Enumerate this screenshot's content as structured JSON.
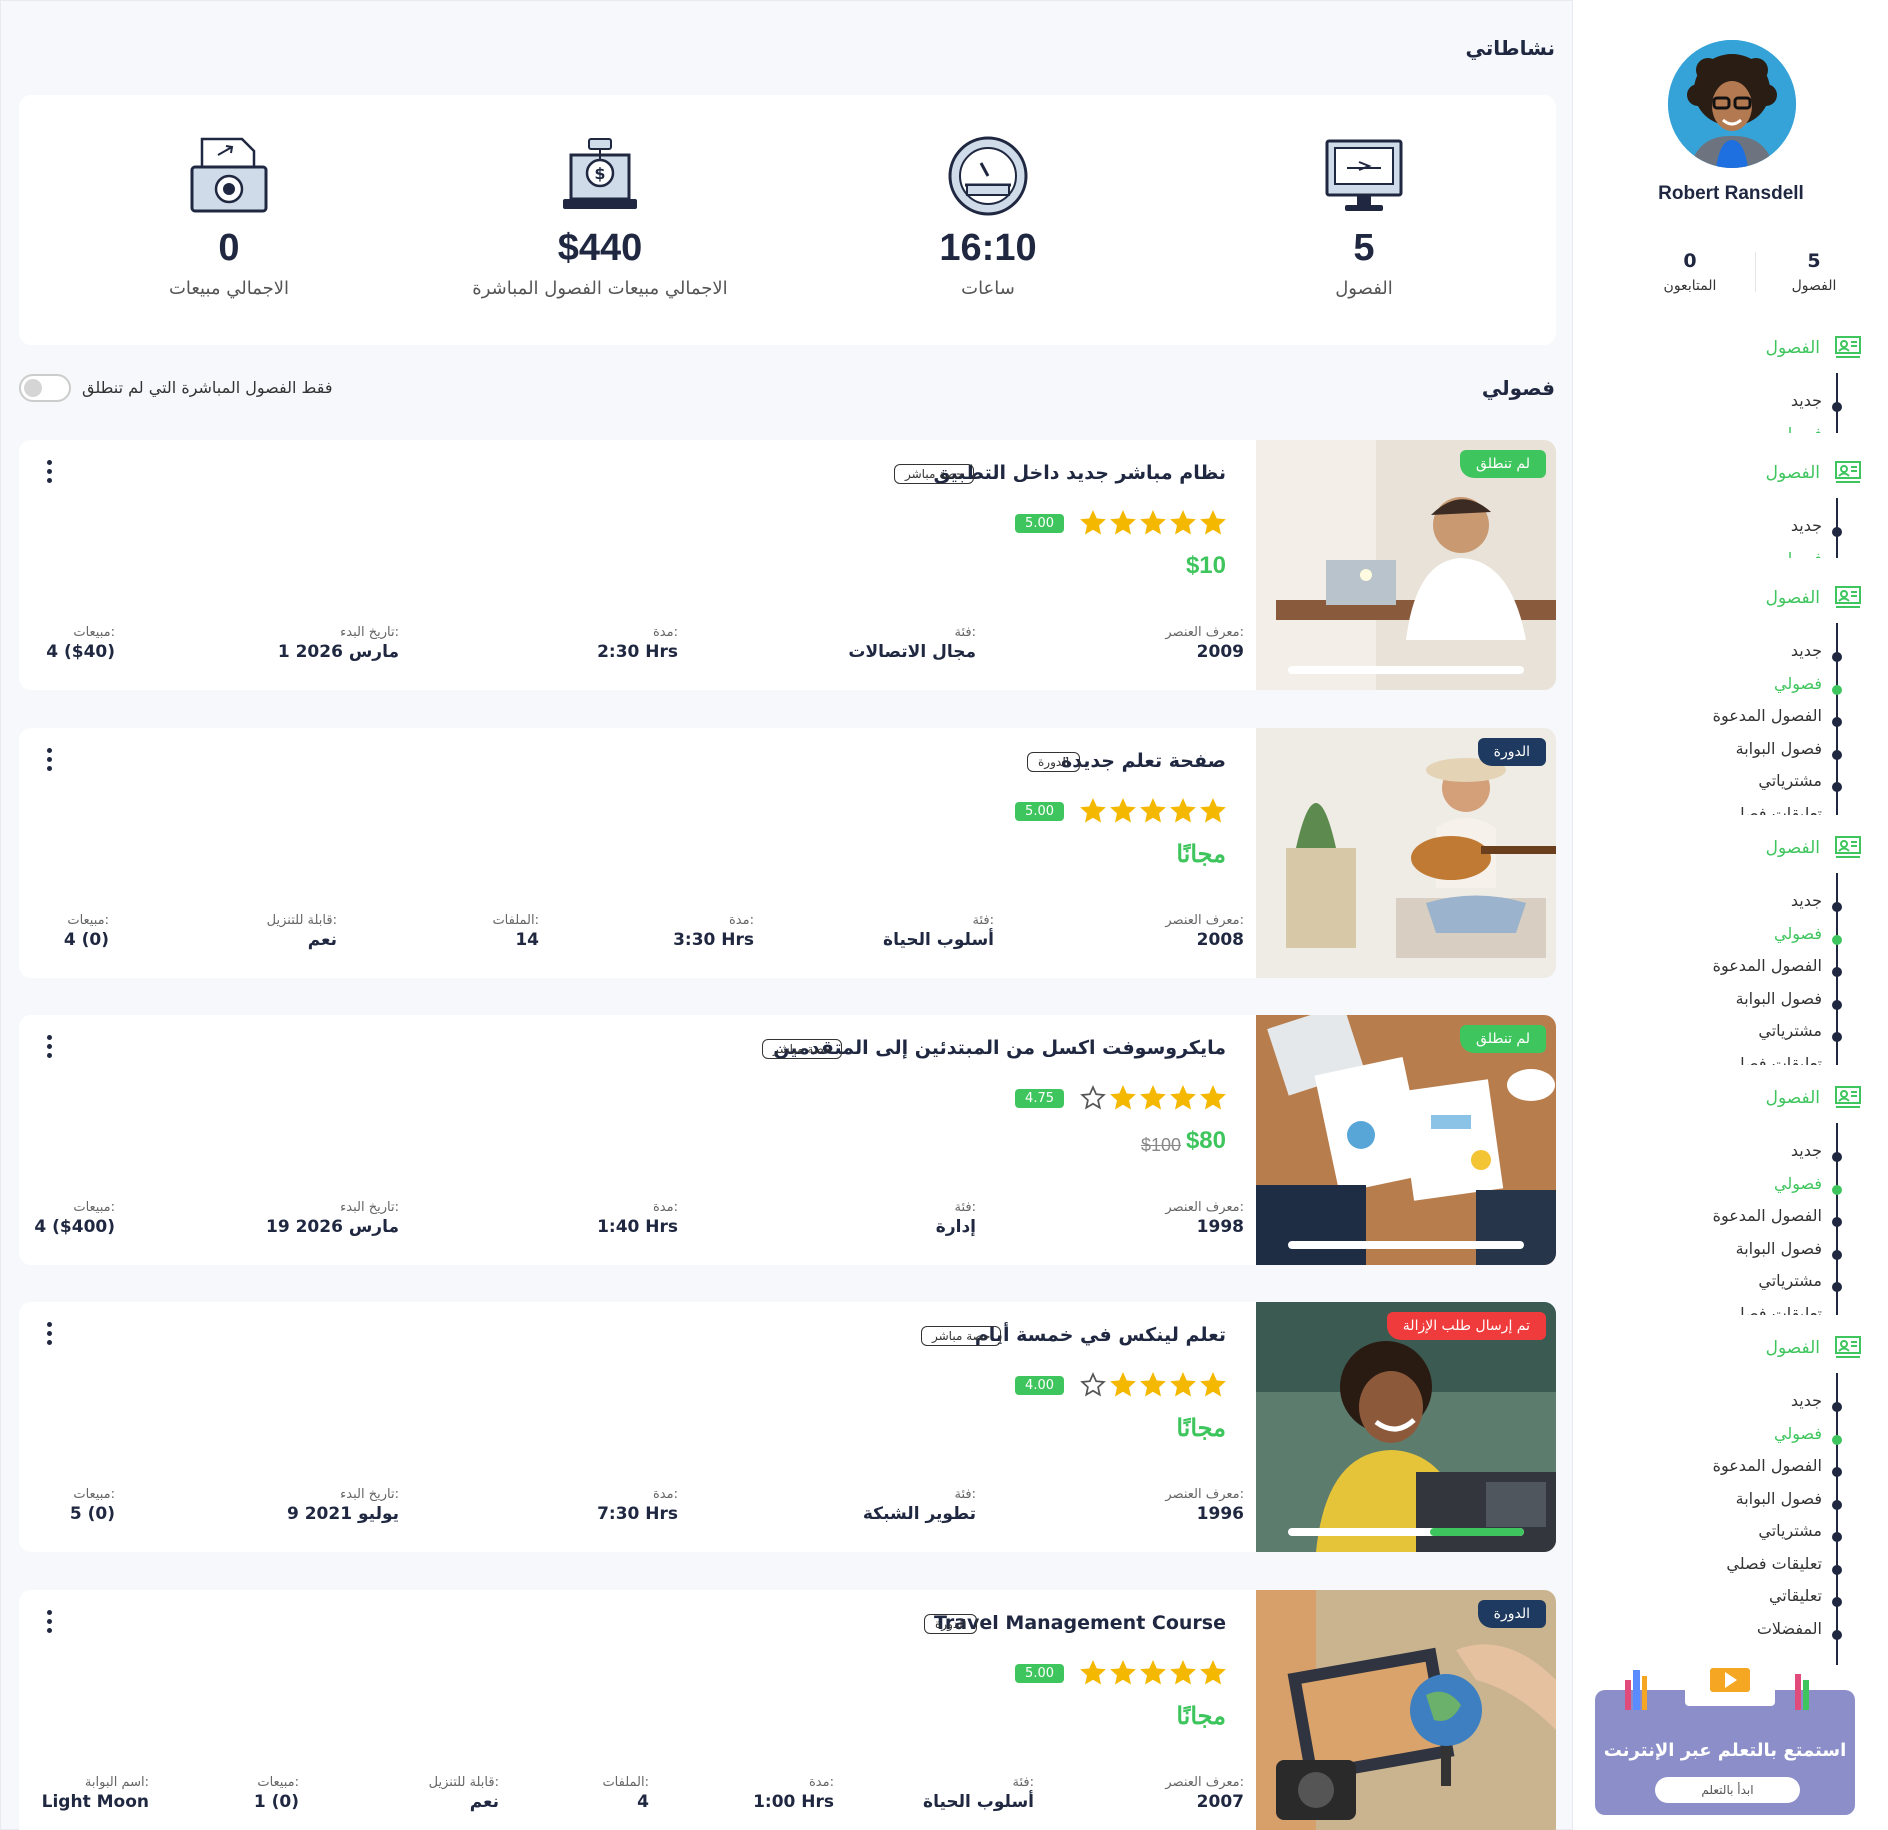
{
  "profile": {
    "name": "Robert Ransdell",
    "stats": [
      {
        "value": "5",
        "label": "الفصول"
      },
      {
        "value": "0",
        "label": "المتابعون"
      }
    ]
  },
  "nav": {
    "section_label": "الفصول",
    "sections": [
      {
        "items": [
          {
            "label": "جديد",
            "active": false
          },
          {
            "label": "فصولي",
            "active": true
          }
        ]
      },
      {
        "items": [
          {
            "label": "جديد",
            "active": false
          },
          {
            "label": "فصولي",
            "active": true
          }
        ]
      },
      {
        "items": [
          {
            "label": "جديد",
            "active": false
          },
          {
            "label": "فصولي",
            "active": true
          },
          {
            "label": "الفصول المدعوة",
            "active": false
          },
          {
            "label": "فصول البوابة",
            "active": false
          },
          {
            "label": "مشترياتي",
            "active": false
          },
          {
            "label": "تعليقات فصلي",
            "active": false
          }
        ]
      },
      {
        "items": [
          {
            "label": "جديد",
            "active": false
          },
          {
            "label": "فصولي",
            "active": true
          },
          {
            "label": "الفصول المدعوة",
            "active": false
          },
          {
            "label": "فصول البوابة",
            "active": false
          },
          {
            "label": "مشترياتي",
            "active": false
          },
          {
            "label": "تعليقات فصلي",
            "active": false
          }
        ]
      },
      {
        "items": [
          {
            "label": "جديد",
            "active": false
          },
          {
            "label": "فصولي",
            "active": true
          },
          {
            "label": "الفصول المدعوة",
            "active": false
          },
          {
            "label": "فصول البوابة",
            "active": false
          },
          {
            "label": "مشترياتي",
            "active": false
          },
          {
            "label": "تعليقات فصلي",
            "active": false
          }
        ]
      },
      {
        "items": [
          {
            "label": "جديد",
            "active": false
          },
          {
            "label": "فصولي",
            "active": true
          },
          {
            "label": "الفصول المدعوة",
            "active": false
          },
          {
            "label": "فصول البوابة",
            "active": false
          },
          {
            "label": "مشترياتي",
            "active": false
          },
          {
            "label": "تعليقات فصلي",
            "active": false
          },
          {
            "label": "تعليقاتي",
            "active": false
          },
          {
            "label": "المفضلات",
            "active": false
          }
        ]
      }
    ]
  },
  "activities": {
    "title": "نشاطاتي",
    "stats": [
      {
        "value": "5",
        "label": "الفصول",
        "icon": "monitor-icon"
      },
      {
        "value": "16:10",
        "label": "ساعات",
        "icon": "gauge-icon"
      },
      {
        "value": "$440",
        "label": "الاجمالي مبيعات الفصول المباشرة",
        "icon": "laptop-dollar-icon"
      },
      {
        "value": "0",
        "label": "الاجمالي مبيعات",
        "icon": "money-icon"
      }
    ]
  },
  "classes": {
    "title": "فصولي",
    "toggle_label": "فقط الفصول المباشرة التي لم تنطلق",
    "items": [
      {
        "badge": "لم تنطلق",
        "badge_color": "#3fc55d",
        "title": "نظام مباشر جديد داخل التطبيق",
        "type": "حصة مباشر",
        "rating": "5.00",
        "stars": 5,
        "price": "$10",
        "old_price": "",
        "progress": 0,
        "meta": [
          {
            "k": "معرف العنصر:",
            "v": "2009"
          },
          {
            "k": "فئة:",
            "v": "مجال الاتصالات"
          },
          {
            "k": "مدة:",
            "v": "2:30 Hrs"
          },
          {
            "k": "تاريخ البدء:",
            "v": "1 مارس 2026"
          },
          {
            "k": "مبيعات:",
            "v": "4 ($40)"
          }
        ]
      },
      {
        "badge": "الدورة",
        "badge_color": "#1f3a60",
        "title": "صفحة تعلم جديدة",
        "type": "الدورة",
        "rating": "5.00",
        "stars": 5,
        "price": "مجانًا",
        "old_price": "",
        "meta": [
          {
            "k": "معرف العنصر:",
            "v": "2008"
          },
          {
            "k": "فئة:",
            "v": "أسلوب الحياة"
          },
          {
            "k": "مدة:",
            "v": "3:30 Hrs"
          },
          {
            "k": "الملفات:",
            "v": "14"
          },
          {
            "k": "قابلة للتنزيل:",
            "v": "نعم"
          },
          {
            "k": "مبيعات:",
            "v": "4 (0)"
          }
        ]
      },
      {
        "badge": "لم تنطلق",
        "badge_color": "#3fc55d",
        "title": "مايكروسوفت اكسل من المبتدئين إلى المتقدمين",
        "type": "حصة مباشر",
        "rating": "4.75",
        "stars": 4,
        "price": "$80",
        "old_price": "$100",
        "progress": 0,
        "meta": [
          {
            "k": "معرف العنصر:",
            "v": "1998"
          },
          {
            "k": "فئة:",
            "v": "إدارة"
          },
          {
            "k": "مدة:",
            "v": "1:40 Hrs"
          },
          {
            "k": "تاريخ البدء:",
            "v": "19 مارس 2026"
          },
          {
            "k": "مبيعات:",
            "v": "4 ($400)"
          }
        ]
      },
      {
        "badge": "تم إرسال طلب الإزالة",
        "badge_color": "#ef3b3b",
        "title": "تعلم لينكس في خمسة أيام",
        "type": "حصة مباشر",
        "rating": "4.00",
        "stars": 4,
        "price": "مجانًا",
        "old_price": "",
        "progress": 0.4,
        "meta": [
          {
            "k": "معرف العنصر:",
            "v": "1996"
          },
          {
            "k": "فئة:",
            "v": "تطوير الشبكة"
          },
          {
            "k": "مدة:",
            "v": "7:30 Hrs"
          },
          {
            "k": "تاريخ البدء:",
            "v": "9 يوليو 2021"
          },
          {
            "k": "مبيعات:",
            "v": "5 (0)"
          }
        ]
      },
      {
        "badge": "الدورة",
        "badge_color": "#1f3a60",
        "title": "Travel Management Course",
        "type": "الدورة",
        "rating": "5.00",
        "stars": 5,
        "price": "مجانًا",
        "old_price": "",
        "meta": [
          {
            "k": "معرف العنصر:",
            "v": "2007"
          },
          {
            "k": "فئة:",
            "v": "أسلوب الحياة"
          },
          {
            "k": "مدة:",
            "v": "1:00 Hrs"
          },
          {
            "k": "الملفات:",
            "v": "4"
          },
          {
            "k": "قابلة للتنزيل:",
            "v": "نعم"
          },
          {
            "k": "مبيعات:",
            "v": "1 (0)"
          },
          {
            "k": "اسم البوابة:",
            "v": "Light Moon"
          }
        ]
      }
    ]
  },
  "promo": {
    "title": "استمتع بالتعلم عبر الإنترنت",
    "button": "ابدأ بالتعلم"
  }
}
